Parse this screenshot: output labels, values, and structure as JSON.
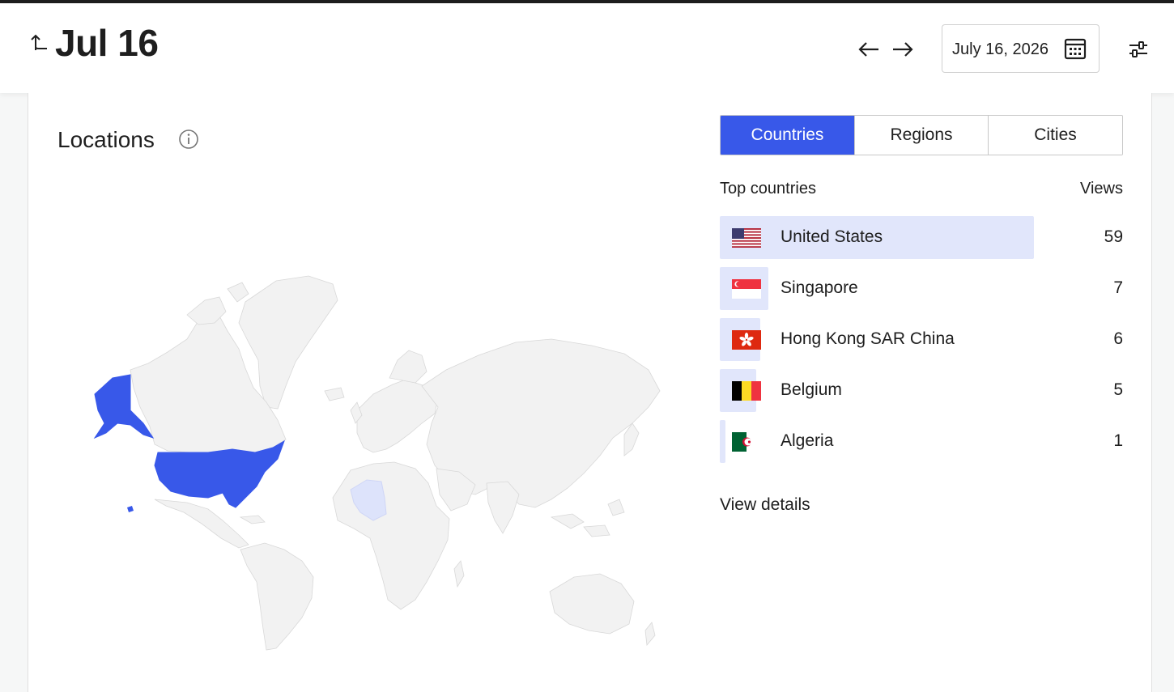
{
  "header": {
    "title": "Jul 16",
    "date_value": "July 16, 2026",
    "icons": [
      "back-arrow-icon",
      "arrow-left-icon",
      "arrow-right-icon",
      "calendar-icon",
      "sliders-icon"
    ]
  },
  "locations": {
    "title": "Locations",
    "tabs": [
      {
        "label": "Countries",
        "active": true
      },
      {
        "label": "Regions",
        "active": false
      },
      {
        "label": "Cities",
        "active": false
      }
    ],
    "list_header": {
      "name": "Top countries",
      "value": "Views"
    },
    "rows": [
      {
        "name": "United States",
        "views": "59",
        "share": 0.78,
        "flag": "us"
      },
      {
        "name": "Singapore",
        "views": "7",
        "share": 0.12,
        "flag": "sg"
      },
      {
        "name": "Hong Kong SAR China",
        "views": "6",
        "share": 0.1,
        "flag": "hk"
      },
      {
        "name": "Belgium",
        "views": "5",
        "share": 0.09,
        "flag": "be"
      },
      {
        "name": "Algeria",
        "views": "1",
        "share": 0.015,
        "flag": "dz"
      }
    ],
    "view_details": "View details"
  },
  "colors": {
    "accent": "#3858e9",
    "bar": "#e1e6fb",
    "map_land": "#f2f2f2",
    "map_highlight": "#3858e9",
    "map_light": "#dde3fb"
  }
}
